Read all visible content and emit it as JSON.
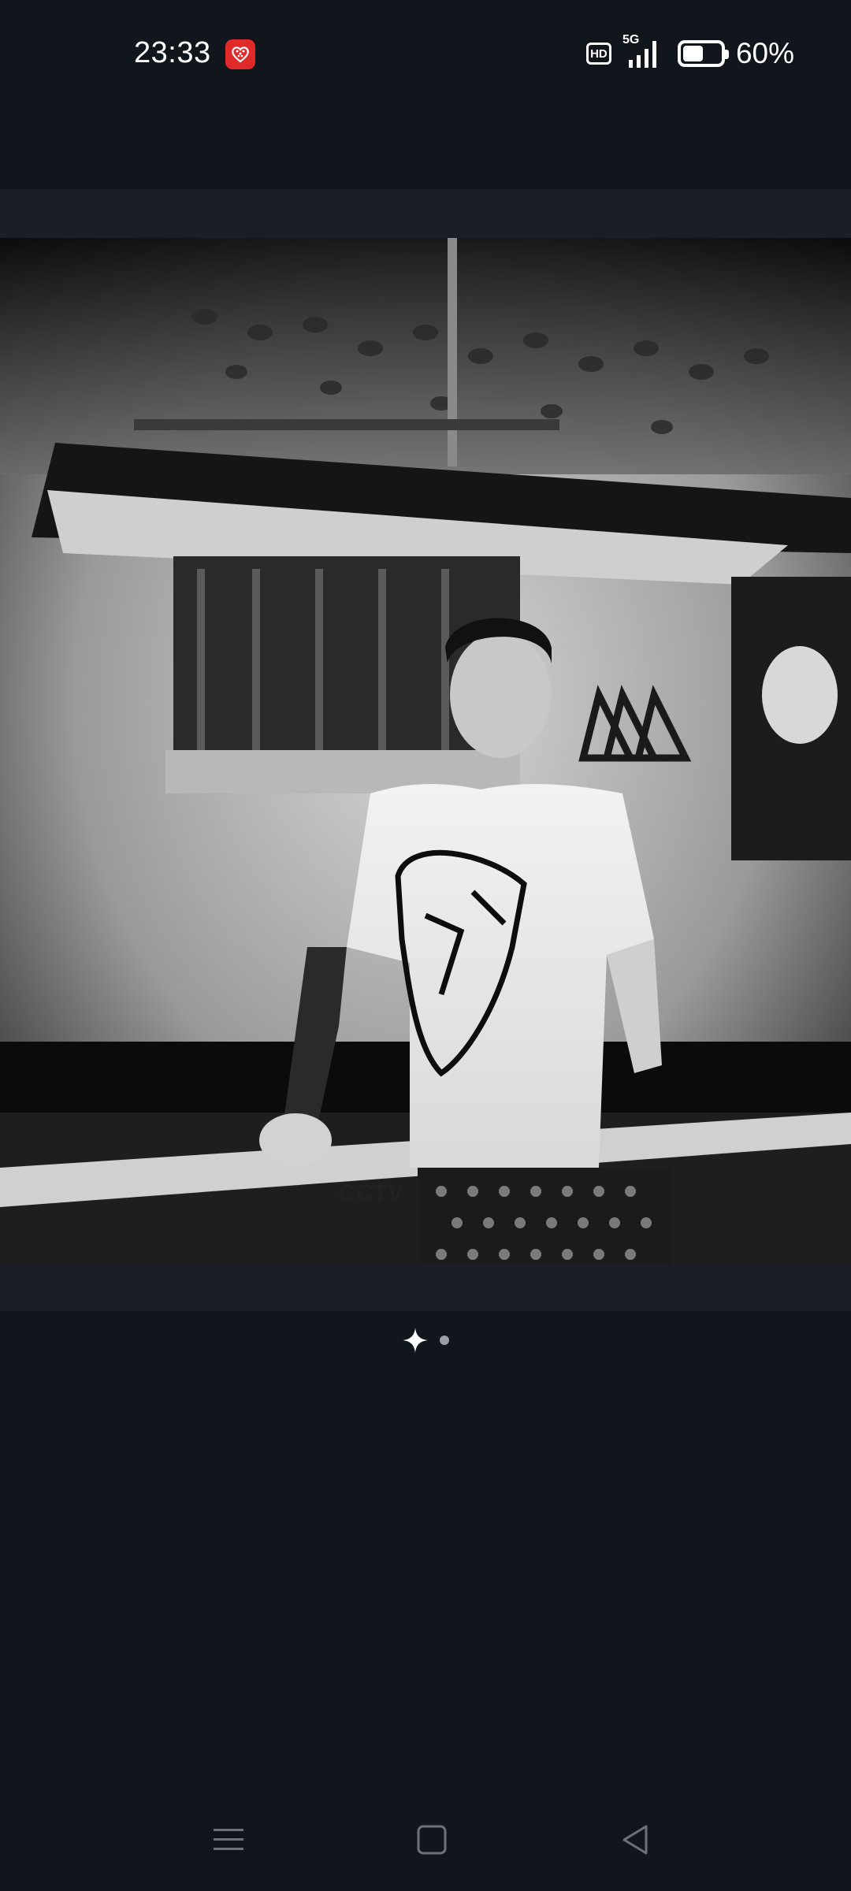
{
  "status_bar": {
    "time": "23:33",
    "hd_label": "HD",
    "network_label": "5G",
    "battery_percent": 60,
    "battery_text": "60%",
    "app_badge_icon": "heart-app-icon",
    "app_badge_color": "#e02a2a"
  },
  "viewer": {
    "image_icon": "photo",
    "pager": {
      "current_icon": "sparkle-icon",
      "total_pages": 2,
      "current_page": 1
    }
  },
  "nav_bar": {
    "menu_icon": "menu-icon",
    "home_icon": "home-icon",
    "back_icon": "back-icon"
  },
  "colors": {
    "background": "#11161c",
    "photo_band": "#1a1f25",
    "nav_icon": "#6b7178"
  }
}
